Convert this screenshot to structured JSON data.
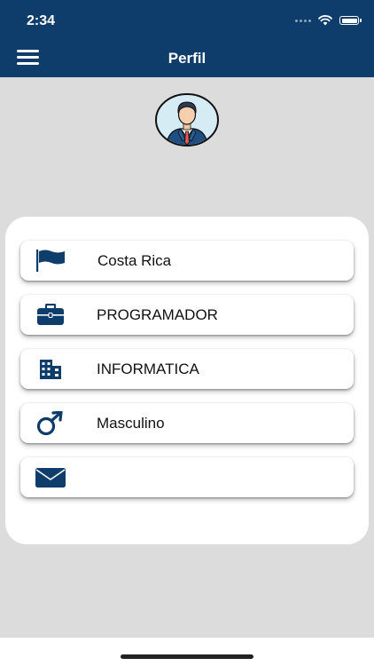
{
  "status_bar": {
    "time": "2:34"
  },
  "header": {
    "title": "Perfil",
    "menu_icon": "hamburger-menu-icon"
  },
  "avatar": {
    "icon": "user-avatar-businessman"
  },
  "colors": {
    "primary": "#0e3d6b",
    "background": "#dcdcdc",
    "card": "#ffffff"
  },
  "profile": {
    "items": [
      {
        "icon": "flag-icon",
        "label": "Costa Rica"
      },
      {
        "icon": "briefcase-icon",
        "label": "PROGRAMADOR"
      },
      {
        "icon": "building-icon",
        "label": "INFORMATICA"
      },
      {
        "icon": "male-gender-icon",
        "label": "Masculino"
      },
      {
        "icon": "envelope-icon",
        "label": ""
      }
    ]
  }
}
